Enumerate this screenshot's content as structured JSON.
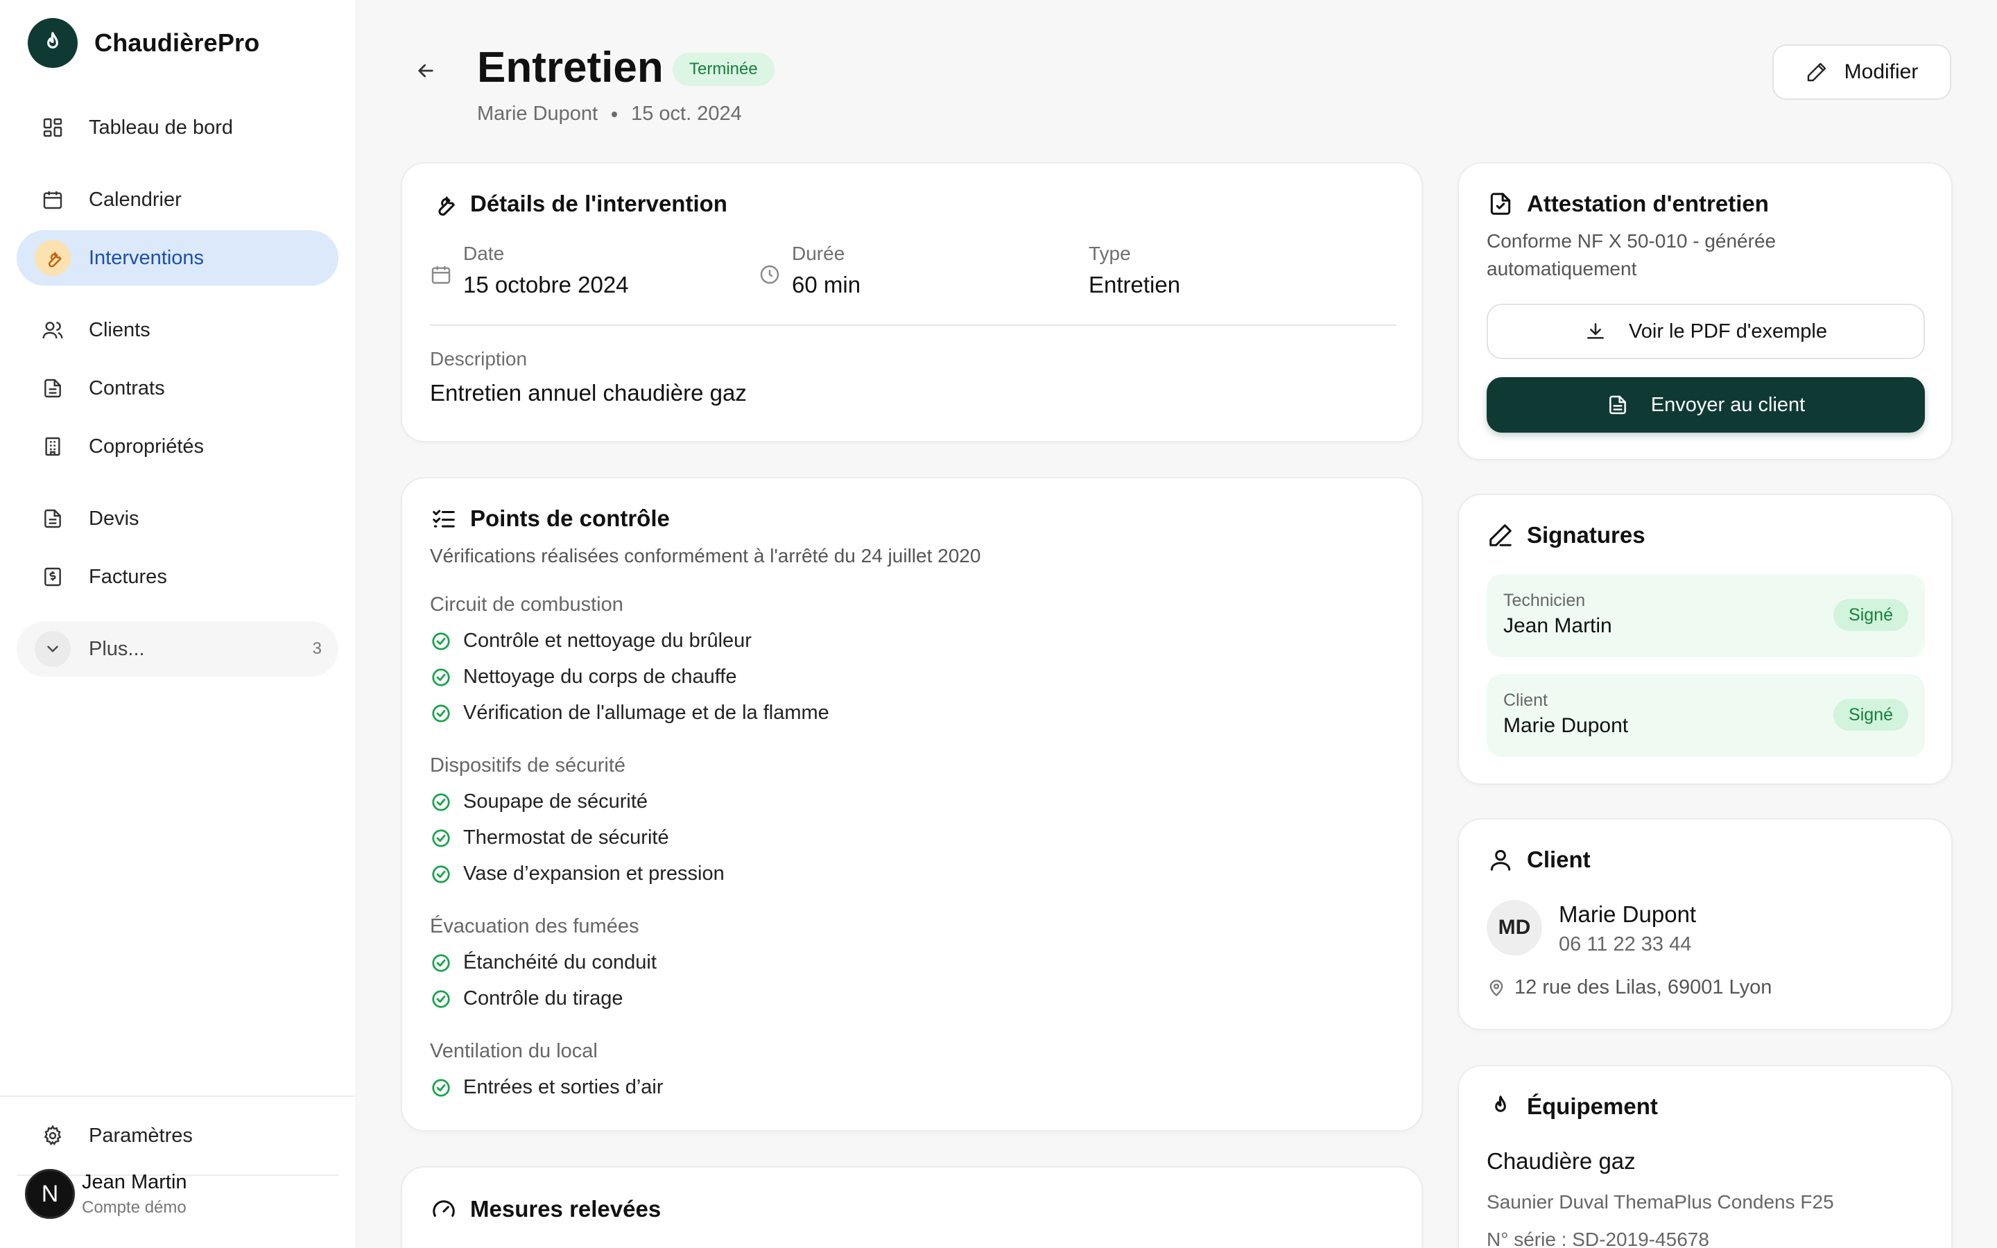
{
  "app": {
    "name": "ChaudièrePro"
  },
  "sidebar": {
    "items": [
      {
        "label": "Tableau de bord",
        "icon": "dashboard-icon"
      },
      {
        "label": "Calendrier",
        "icon": "calendar-icon"
      },
      {
        "label": "Interventions",
        "icon": "wrench-icon",
        "active": true
      },
      {
        "label": "Clients",
        "icon": "users-icon"
      },
      {
        "label": "Contrats",
        "icon": "document-icon"
      },
      {
        "label": "Copropriétés",
        "icon": "building-icon"
      },
      {
        "label": "Devis",
        "icon": "document-icon"
      },
      {
        "label": "Factures",
        "icon": "invoice-icon"
      }
    ],
    "more": {
      "label": "Plus...",
      "count": "3"
    },
    "settings": {
      "label": "Paramètres"
    },
    "user": {
      "initial": "N",
      "name": "Jean Martin",
      "subtitle": "Compte démo"
    }
  },
  "header": {
    "title": "Entretien",
    "status": "Terminée",
    "client": "Marie Dupont",
    "date": "15 oct. 2024",
    "edit_label": "Modifier"
  },
  "details": {
    "title": "Détails de l'intervention",
    "date_label": "Date",
    "date_value": "15 octobre 2024",
    "duration_label": "Durée",
    "duration_value": "60 min",
    "type_label": "Type",
    "type_value": "Entretien",
    "description_label": "Description",
    "description_value": "Entretien annuel chaudière gaz"
  },
  "checkpoints": {
    "title": "Points de contrôle",
    "subtitle": "Vérifications réalisées conformément à l'arrêté du 24 juillet 2020",
    "groups": [
      {
        "label": "Circuit de combustion",
        "items": [
          "Contrôle et nettoyage du brûleur",
          "Nettoyage du corps de chauffe",
          "Vérification de l'allumage et de la flamme"
        ]
      },
      {
        "label": "Dispositifs de sécurité",
        "items": [
          "Soupape de sécurité",
          "Thermostat de sécurité",
          "Vase d’expansion et pression"
        ]
      },
      {
        "label": "Évacuation des fumées",
        "items": [
          "Étanchéité du conduit",
          "Contrôle du tirage"
        ]
      },
      {
        "label": "Ventilation du local",
        "items": [
          "Entrées et sorties d’air"
        ]
      }
    ]
  },
  "measures": {
    "title": "Mesures relevées"
  },
  "attestation": {
    "title": "Attestation d'entretien",
    "description_line1": "Conforme NF X 50-010 - générée",
    "description_line2": "automatiquement",
    "pdf_label": "Voir le PDF d'exemple",
    "send_label": "Envoyer au client"
  },
  "signatures": {
    "title": "Signatures",
    "items": [
      {
        "role": "Technicien",
        "name": "Jean Martin",
        "status": "Signé"
      },
      {
        "role": "Client",
        "name": "Marie Dupont",
        "status": "Signé"
      }
    ]
  },
  "client": {
    "title": "Client",
    "initials": "MD",
    "name": "Marie Dupont",
    "phone": "06 11 22 33 44",
    "address": "12 rue des Lilas, 69001 Lyon"
  },
  "equipment": {
    "title": "Équipement",
    "name": "Chaudière gaz",
    "model": "Saunier Duval ThemaPlus Condens F25",
    "serial": "N° série : SD-2019-45678"
  },
  "colors": {
    "brand": "#0f3a34",
    "success": "#15803d",
    "active_nav_bg": "#dbe9fb",
    "active_nav_text": "#1e4fa8"
  }
}
